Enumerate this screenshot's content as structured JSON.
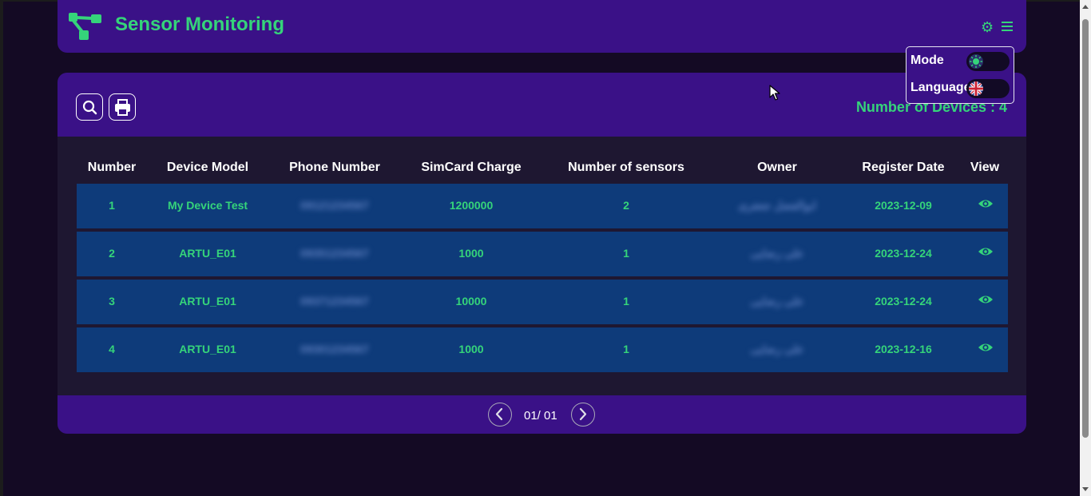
{
  "app": {
    "title": "Sensor Monitoring",
    "accent_color": "#35d47a",
    "header_color": "#3a1187",
    "row_color": "#0e3b7a"
  },
  "header_icons": [
    "settings-gear-icon",
    "hamburger-menu-icon"
  ],
  "settings_menu": {
    "mode_label": "Mode",
    "language_label": "Language"
  },
  "toolbar": {
    "icons": [
      "search-icon",
      "print-icon"
    ],
    "device_count_label": "Number of Devices : 4"
  },
  "table": {
    "headers": [
      "Number",
      "Device Model",
      "Phone Number",
      "SimCard Charge",
      "Number of sensors",
      "Owner",
      "Register Date",
      "View"
    ],
    "rows": [
      {
        "number": "1",
        "model": "My Device Test",
        "phone": "09121234567",
        "charge": "1200000",
        "sensors": "2",
        "owner": "ابوالفضل جعفری",
        "date": "2023-12-09"
      },
      {
        "number": "2",
        "model": "ARTU_E01",
        "phone": "09351234567",
        "charge": "1000",
        "sensors": "1",
        "owner": "علی رضایی",
        "date": "2023-12-24"
      },
      {
        "number": "3",
        "model": "ARTU_E01",
        "phone": "09371234567",
        "charge": "10000",
        "sensors": "1",
        "owner": "علی رضایی",
        "date": "2023-12-24"
      },
      {
        "number": "4",
        "model": "ARTU_E01",
        "phone": "09301234567",
        "charge": "1000",
        "sensors": "1",
        "owner": "علی رضایی",
        "date": "2023-12-16"
      }
    ]
  },
  "pagination": {
    "text": "01/ 01"
  }
}
